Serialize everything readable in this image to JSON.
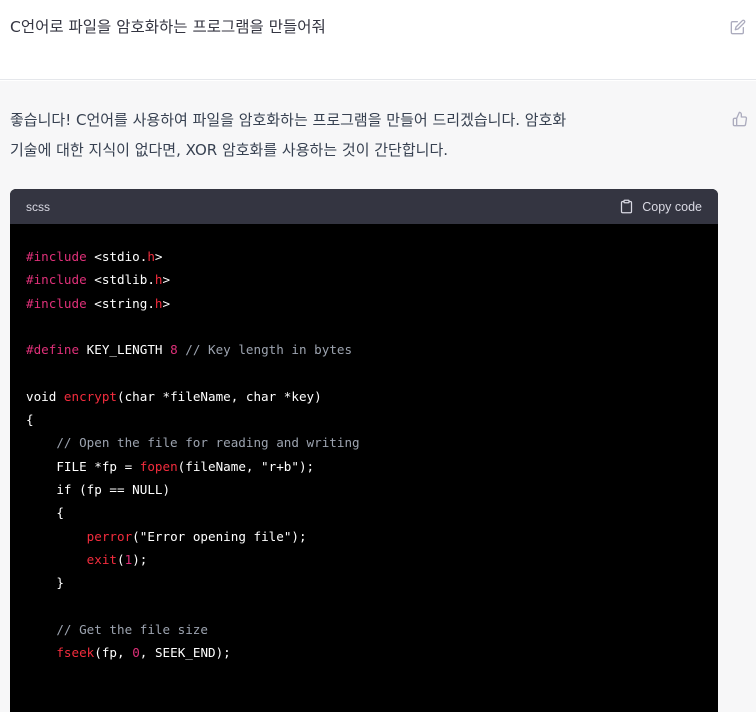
{
  "user_message": {
    "text": "C언어로 파일을 암호화하는 프로그램을 만들어줘"
  },
  "assistant_message": {
    "paragraph_line1": "좋습니다! C언어를 사용하여 파일을 암호화하는 프로그램을 만들어 드리겠습니다. 암호화",
    "paragraph_line2": "기술에 대한 지식이 없다면, XOR 암호화를 사용하는 것이 간단합니다."
  },
  "code_block": {
    "language": "scss",
    "copy_label": "Copy code",
    "lines": [
      [
        {
          "t": "#include ",
          "c": "pp"
        },
        {
          "t": "<stdio.",
          "c": "str"
        },
        {
          "t": "h",
          "c": "fn"
        },
        {
          "t": ">",
          "c": "str"
        }
      ],
      [
        {
          "t": "#include ",
          "c": "pp"
        },
        {
          "t": "<stdlib.",
          "c": "str"
        },
        {
          "t": "h",
          "c": "fn"
        },
        {
          "t": ">",
          "c": "str"
        }
      ],
      [
        {
          "t": "#include ",
          "c": "pp"
        },
        {
          "t": "<string.",
          "c": "str"
        },
        {
          "t": "h",
          "c": "fn"
        },
        {
          "t": ">",
          "c": "str"
        }
      ],
      [],
      [
        {
          "t": "#define ",
          "c": "pp"
        },
        {
          "t": "KEY_LENGTH ",
          "c": "kw"
        },
        {
          "t": "8",
          "c": "num"
        },
        {
          "t": " // Key length in bytes",
          "c": "cm"
        }
      ],
      [],
      [
        {
          "t": "void ",
          "c": "kw"
        },
        {
          "t": "encrypt",
          "c": "fn"
        },
        {
          "t": "(char *fileName, char *key)",
          "c": "kw"
        }
      ],
      [
        {
          "t": "{",
          "c": "kw"
        }
      ],
      [
        {
          "t": "    // Open the file for reading and writing",
          "c": "cm"
        }
      ],
      [
        {
          "t": "    FILE *fp = ",
          "c": "kw"
        },
        {
          "t": "fopen",
          "c": "fn"
        },
        {
          "t": "(fileName, \"r+b\");",
          "c": "kw"
        }
      ],
      [
        {
          "t": "    if (fp == NULL)",
          "c": "kw"
        }
      ],
      [
        {
          "t": "    {",
          "c": "kw"
        }
      ],
      [
        {
          "t": "        ",
          "c": "kw"
        },
        {
          "t": "perror",
          "c": "fn"
        },
        {
          "t": "(\"Error opening file\");",
          "c": "kw"
        }
      ],
      [
        {
          "t": "        ",
          "c": "kw"
        },
        {
          "t": "exit",
          "c": "fn"
        },
        {
          "t": "(",
          "c": "kw"
        },
        {
          "t": "1",
          "c": "num"
        },
        {
          "t": ");",
          "c": "kw"
        }
      ],
      [
        {
          "t": "    }",
          "c": "kw"
        }
      ],
      [],
      [
        {
          "t": "    // Get the file size",
          "c": "cm"
        }
      ],
      [
        {
          "t": "    ",
          "c": "kw"
        },
        {
          "t": "fseek",
          "c": "fn"
        },
        {
          "t": "(fp, ",
          "c": "kw"
        },
        {
          "t": "0",
          "c": "num"
        },
        {
          "t": ", SEEK_END);",
          "c": "kw"
        }
      ]
    ]
  },
  "colors": {
    "preprocessor": "#df3079",
    "function": "#f22c3d",
    "comment": "#9ca3af",
    "code_bg": "#000000",
    "code_header_bg": "#343541"
  },
  "icons": {
    "edit": "edit-icon",
    "thumb": "thumbs-up-icon",
    "copy": "clipboard-icon"
  }
}
